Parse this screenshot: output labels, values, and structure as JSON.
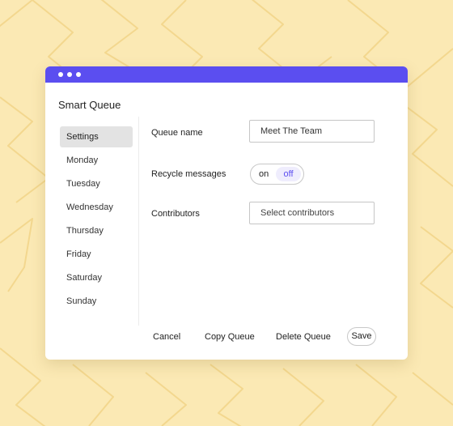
{
  "colors": {
    "accent": "#5b4ef0",
    "background": "#fbe9b4",
    "pattern_line": "#f3d78e"
  },
  "window": {
    "title": "Smart Queue",
    "titlebar_dots": 3
  },
  "sidebar": {
    "items": [
      {
        "label": "Settings",
        "active": true
      },
      {
        "label": "Monday"
      },
      {
        "label": "Tuesday"
      },
      {
        "label": "Wednesday"
      },
      {
        "label": "Thursday"
      },
      {
        "label": "Friday"
      },
      {
        "label": "Saturday"
      },
      {
        "label": "Sunday"
      }
    ]
  },
  "form": {
    "queue_name_label": "Queue name",
    "queue_name_value": "Meet The Team",
    "recycle_label": "Recycle messages",
    "recycle_on": "on",
    "recycle_off": "off",
    "recycle_selected": "off",
    "contributors_label": "Contributors",
    "contributors_placeholder": "Select contributors"
  },
  "footer": {
    "cancel": "Cancel",
    "copy": "Copy Queue",
    "delete": "Delete Queue",
    "save": "Save"
  }
}
